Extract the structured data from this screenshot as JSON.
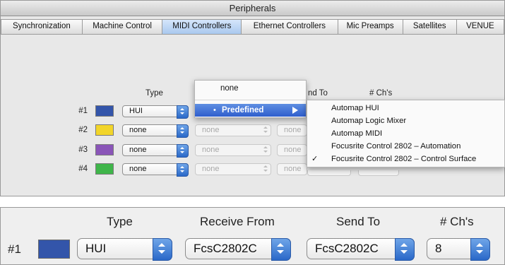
{
  "window": {
    "title": "Peripherals"
  },
  "tabs": [
    {
      "label": "Synchronization"
    },
    {
      "label": "Machine Control"
    },
    {
      "label": "MIDI Controllers",
      "active": true
    },
    {
      "label": "Ethernet Controllers"
    },
    {
      "label": "Mic Preamps"
    },
    {
      "label": "Satellites"
    },
    {
      "label": "VENUE"
    }
  ],
  "table": {
    "headers": {
      "type": "Type",
      "send_partial": "nd To",
      "channels": "# Ch's"
    },
    "rows": [
      {
        "num": "#1",
        "color": "#3355aa",
        "type": "HUI"
      },
      {
        "num": "#2",
        "color": "#f2d52a",
        "type": "none",
        "receive": "none",
        "send": "none"
      },
      {
        "num": "#3",
        "color": "#8a55b8",
        "type": "none",
        "receive": "none",
        "send": "none"
      },
      {
        "num": "#4",
        "color": "#3fb54a",
        "type": "none",
        "receive": "none",
        "send": "none"
      }
    ]
  },
  "menu1": {
    "none": "none",
    "predefined": "Predefined",
    "bullet": "•"
  },
  "menu2": {
    "items": [
      {
        "label": "Automap HUI",
        "checked": false
      },
      {
        "label": "Automap Logic Mixer",
        "checked": false
      },
      {
        "label": "Automap MIDI",
        "checked": false
      },
      {
        "label": "Focusrite Control 2802 – Automation",
        "checked": false
      },
      {
        "label": "Focusrite Control 2802 – Control Surface",
        "checked": true
      }
    ],
    "check": "✓"
  },
  "zoom": {
    "headers": {
      "type": "Type",
      "receive": "Receive From",
      "send": "Send To",
      "channels": "# Ch's"
    },
    "row": {
      "num": "#1",
      "color": "#3355aa",
      "type": "HUI",
      "receive": "FcsC2802C",
      "send": "FcsC2802C",
      "channels": "8"
    }
  }
}
